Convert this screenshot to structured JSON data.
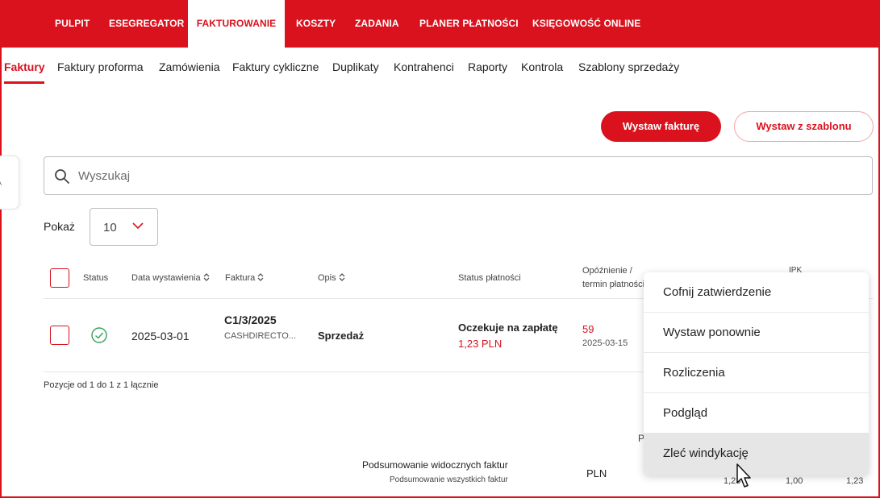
{
  "topnav": {
    "items": [
      {
        "label": "PULPIT"
      },
      {
        "label": "ESEGREGATOR"
      },
      {
        "label": "FAKTUROWANIE",
        "active": true
      },
      {
        "label": "KOSZTY"
      },
      {
        "label": "ZADANIA"
      },
      {
        "label": "PLANER PŁATNOŚCI"
      },
      {
        "label": "KSIĘGOWOŚĆ ONLINE"
      }
    ]
  },
  "subnav": {
    "tabs": [
      {
        "label": "Faktury",
        "active": true
      },
      {
        "label": "Faktury proforma"
      },
      {
        "label": "Zamówienia"
      },
      {
        "label": "Faktury cykliczne"
      },
      {
        "label": "Duplikaty"
      },
      {
        "label": "Kontrahenci"
      },
      {
        "label": "Raporty"
      },
      {
        "label": "Kontrola"
      },
      {
        "label": "Szablony sprzedaży"
      }
    ]
  },
  "actions": {
    "issue_invoice": "Wystaw fakturę",
    "issue_from_template": "Wystaw z szablonu"
  },
  "search": {
    "placeholder": "Wyszukaj",
    "icon": "search-icon"
  },
  "page_size": {
    "label": "Pokaż",
    "value": "10"
  },
  "table": {
    "headers": {
      "status": "Status",
      "issue_date": "Data wystawienia",
      "invoice": "Faktura",
      "description": "Opis",
      "payment_status": "Status płatności",
      "delay_line1": "Opóźnienie /",
      "delay_line2": "termin płatności",
      "partial": "IPK"
    },
    "rows": [
      {
        "status_icon": "check-circle-icon",
        "issue_date": "2025-03-01",
        "invoice_number": "C1/3/2025",
        "client": "CASHDIRECTO...",
        "description": "Sprzedaż",
        "payment_status": "Oczekuje na zapłatę",
        "amount": "1,23 PLN",
        "delay_days": "59",
        "due_date": "2025-03-15"
      }
    ]
  },
  "pagination_note": "Pozycje od 1 do 1 z 1 łącznie",
  "summary": {
    "visible_label": "Podsumowanie widocznych faktur",
    "all_label": "Podsumowanie wszystkich faktur",
    "currency": "PLN",
    "col_label_partial": "P",
    "values": [
      "1,23",
      "1,00",
      "1,23"
    ]
  },
  "context_menu": {
    "items": [
      {
        "label": "Cofnij zatwierdzenie"
      },
      {
        "label": "Wystaw ponownie"
      },
      {
        "label": "Rozliczenia"
      },
      {
        "label": "Podgląd"
      },
      {
        "label": "Zleć windykację",
        "hover": true
      }
    ]
  },
  "colors": {
    "brand": "#d9121e",
    "menu_hover": "#e6e6e6"
  }
}
